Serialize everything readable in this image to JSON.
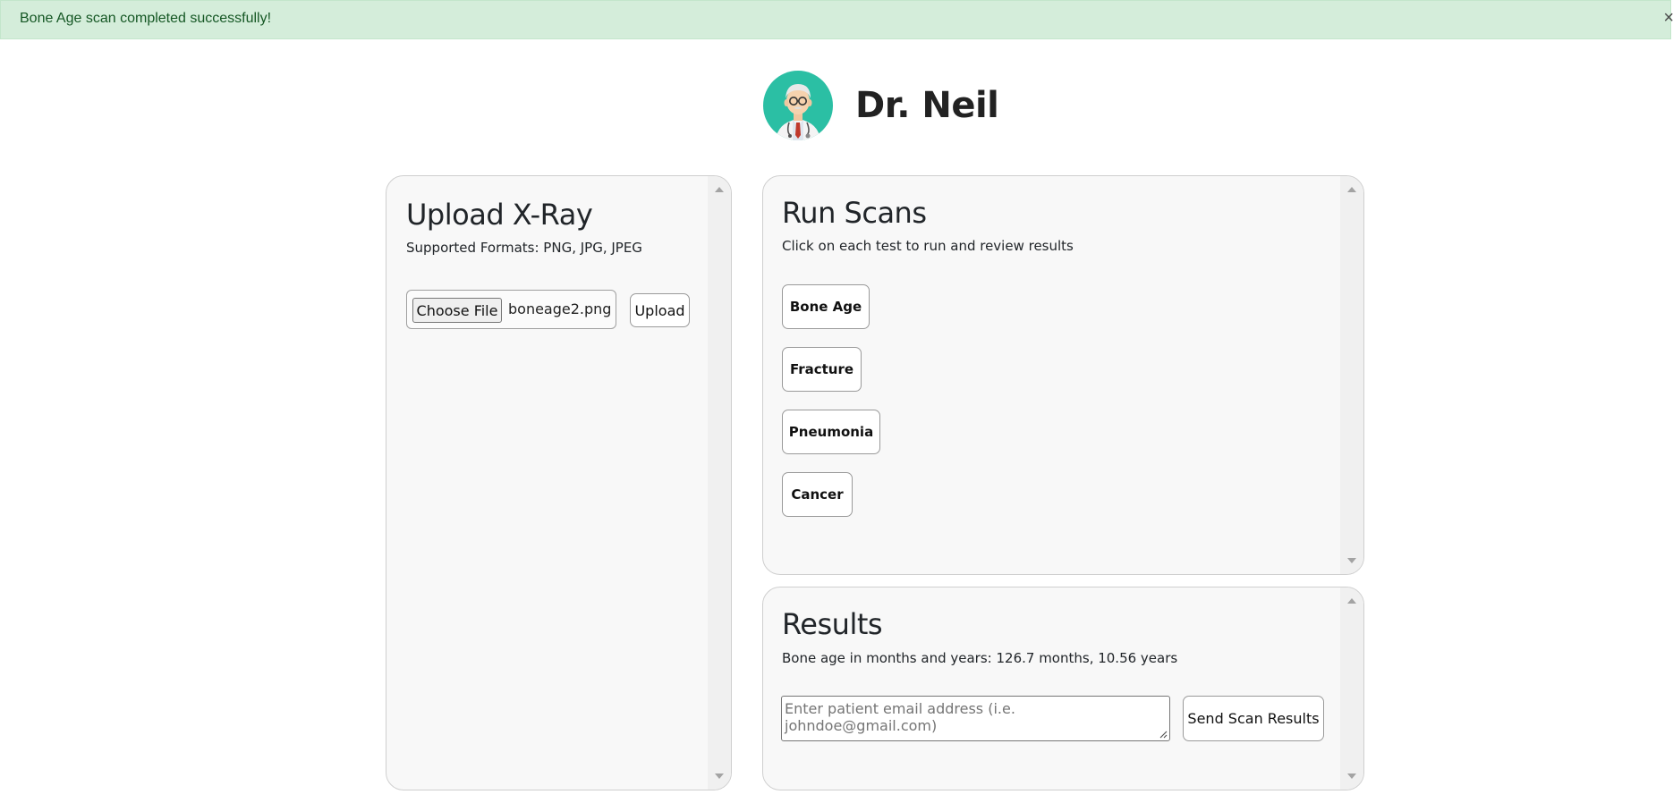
{
  "alert": {
    "message": "Bone Age scan completed successfully!",
    "close": "×"
  },
  "header": {
    "avatar_icon": "doctor-avatar-icon",
    "doctor_name": "Dr. Neil"
  },
  "upload_panel": {
    "title": "Upload X-Ray",
    "formats": "Supported Formats: PNG, JPG, JPEG",
    "choose_file_label": "Choose File",
    "file_name": "boneage2.png",
    "upload_label": "Upload"
  },
  "scans_panel": {
    "title": "Run Scans",
    "subtitle": "Click on each test to run and review results",
    "tests": [
      {
        "label": "Bone Age"
      },
      {
        "label": "Fracture"
      },
      {
        "label": "Pneumonia"
      },
      {
        "label": "Cancer"
      }
    ]
  },
  "results_panel": {
    "title": "Results",
    "result_text": "Bone age in months and years: 126.7 months, 10.56 years",
    "email_placeholder": "Enter patient email address (i.e. johndoe@gmail.com)",
    "send_label": "Send Scan Results"
  },
  "colors": {
    "alert_bg": "#d4edda",
    "alert_text": "#155724",
    "avatar_bg": "#2bbfa4",
    "panel_bg": "#f8f8f8"
  }
}
